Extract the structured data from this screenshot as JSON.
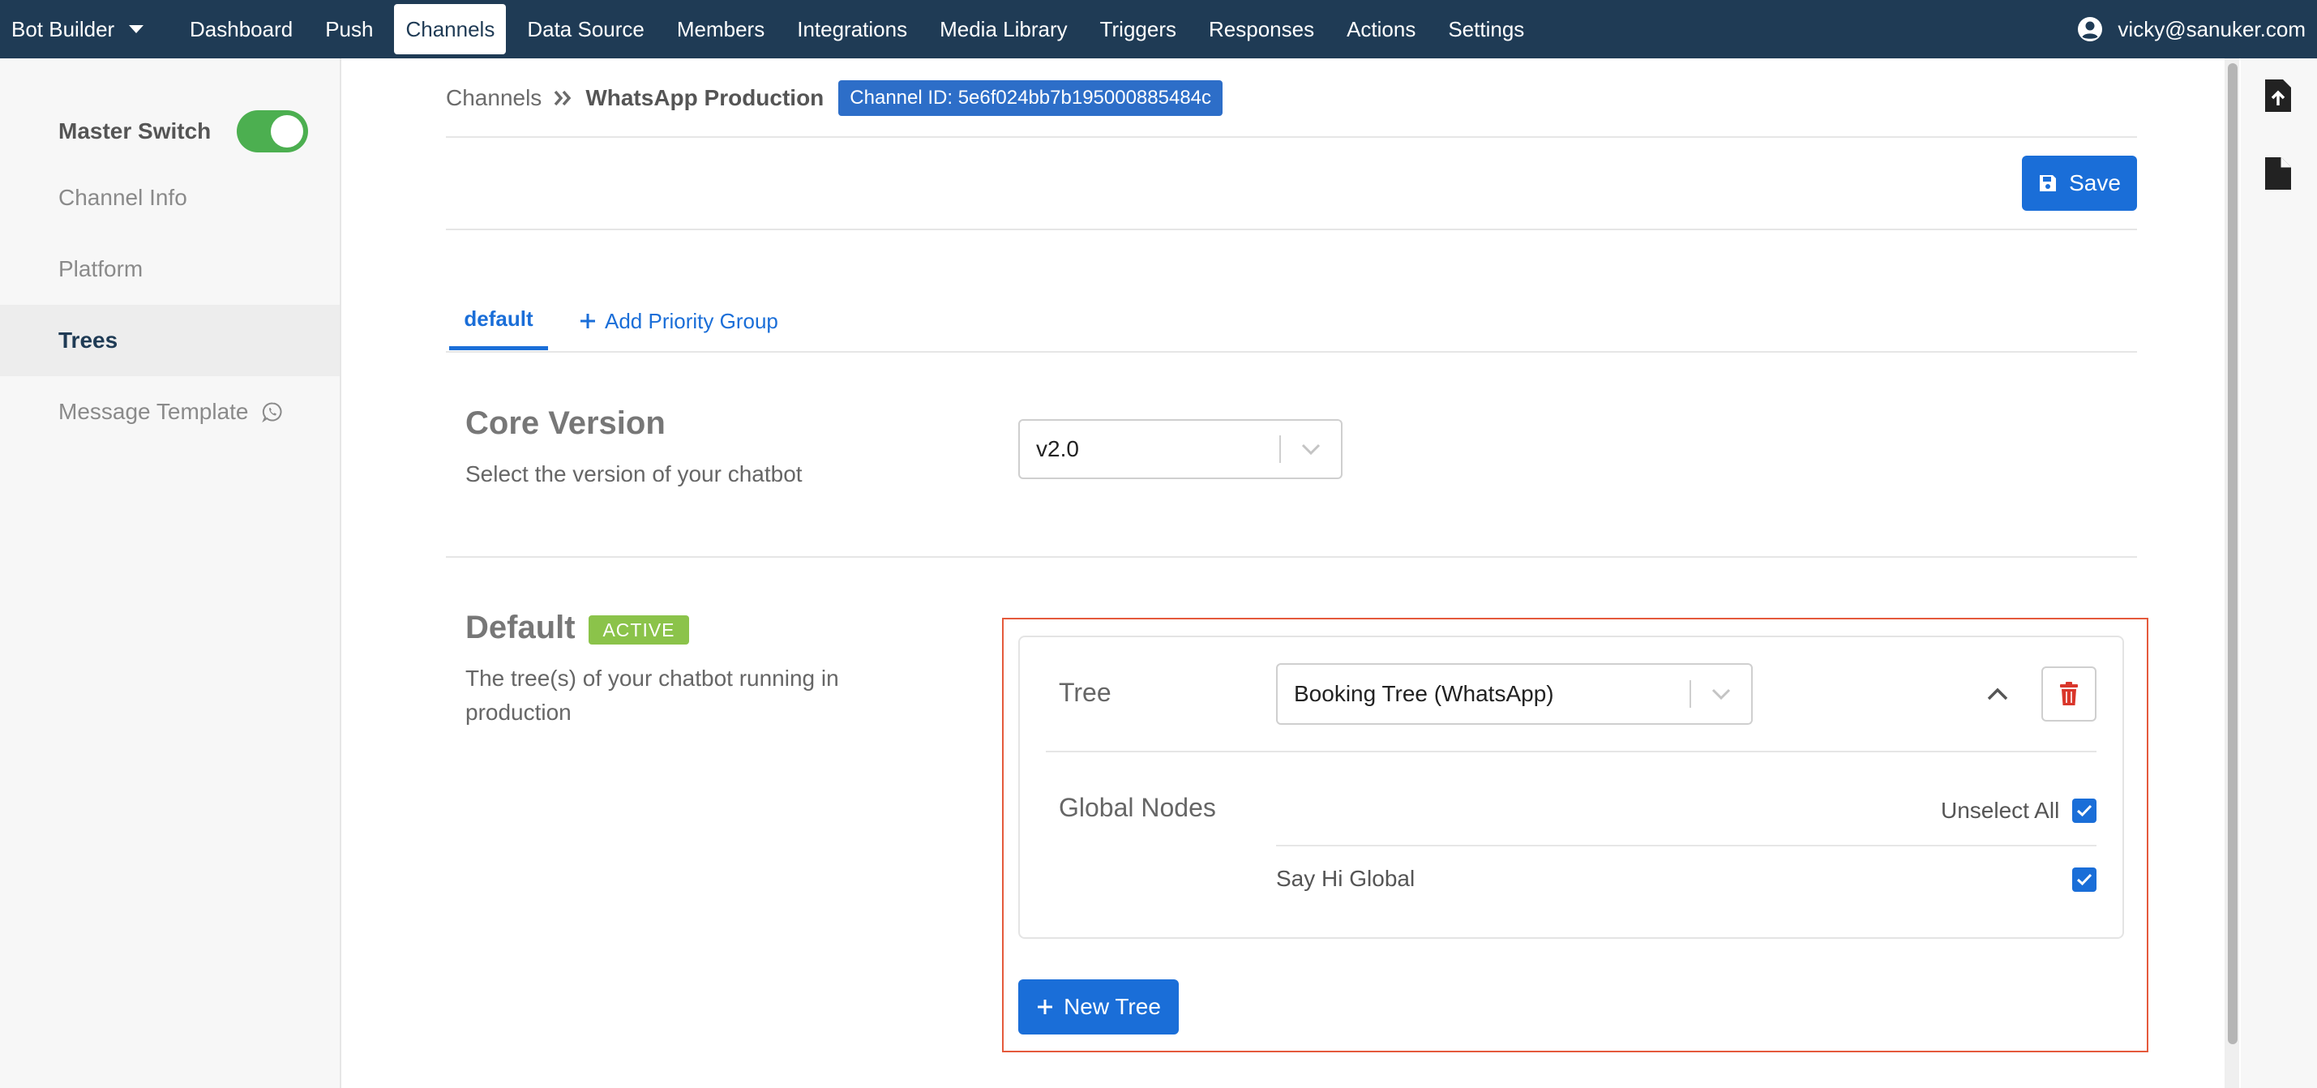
{
  "nav": {
    "brand": "Bot Builder",
    "items": [
      "Dashboard",
      "Push",
      "Channels",
      "Data Source",
      "Members",
      "Integrations",
      "Media Library",
      "Triggers",
      "Responses",
      "Actions",
      "Settings"
    ],
    "active": "Channels",
    "user_email": "vicky@sanuker.com"
  },
  "sidebar": {
    "master_switch_label": "Master Switch",
    "master_switch_on": true,
    "items": [
      {
        "label": "Channel Info",
        "active": false
      },
      {
        "label": "Platform",
        "active": false
      },
      {
        "label": "Trees",
        "active": true
      },
      {
        "label": "Message Template",
        "active": false,
        "icon": "whatsapp-icon"
      }
    ]
  },
  "breadcrumb": {
    "root": "Channels",
    "current": "WhatsApp Production",
    "channel_id": "Channel ID: 5e6f024bb7b195000885484c"
  },
  "toolbar": {
    "save_label": "Save"
  },
  "tabs": {
    "default": "default",
    "add_priority_group": "Add Priority Group"
  },
  "core_version": {
    "title": "Core Version",
    "description": "Select the version of your chatbot",
    "selected": "v2.0"
  },
  "default_section": {
    "title": "Default",
    "badge": "ACTIVE",
    "description_line1": "The tree(s) of your chatbot running in",
    "description_line2": "production",
    "tree_label": "Tree",
    "tree_selected": "Booking Tree (WhatsApp)",
    "global_nodes_label": "Global Nodes",
    "unselect_all_label": "Unselect All",
    "unselect_all_checked": true,
    "nodes": [
      {
        "label": "Say Hi Global",
        "checked": true
      }
    ],
    "new_tree_label": "New Tree"
  },
  "colors": {
    "nav_bg": "#1f3b55",
    "primary": "#1a6ed8",
    "toggle_on": "#4caf50",
    "active_badge": "#8bc34a",
    "danger": "#d9362b",
    "highlight_border": "#e55a3c"
  }
}
